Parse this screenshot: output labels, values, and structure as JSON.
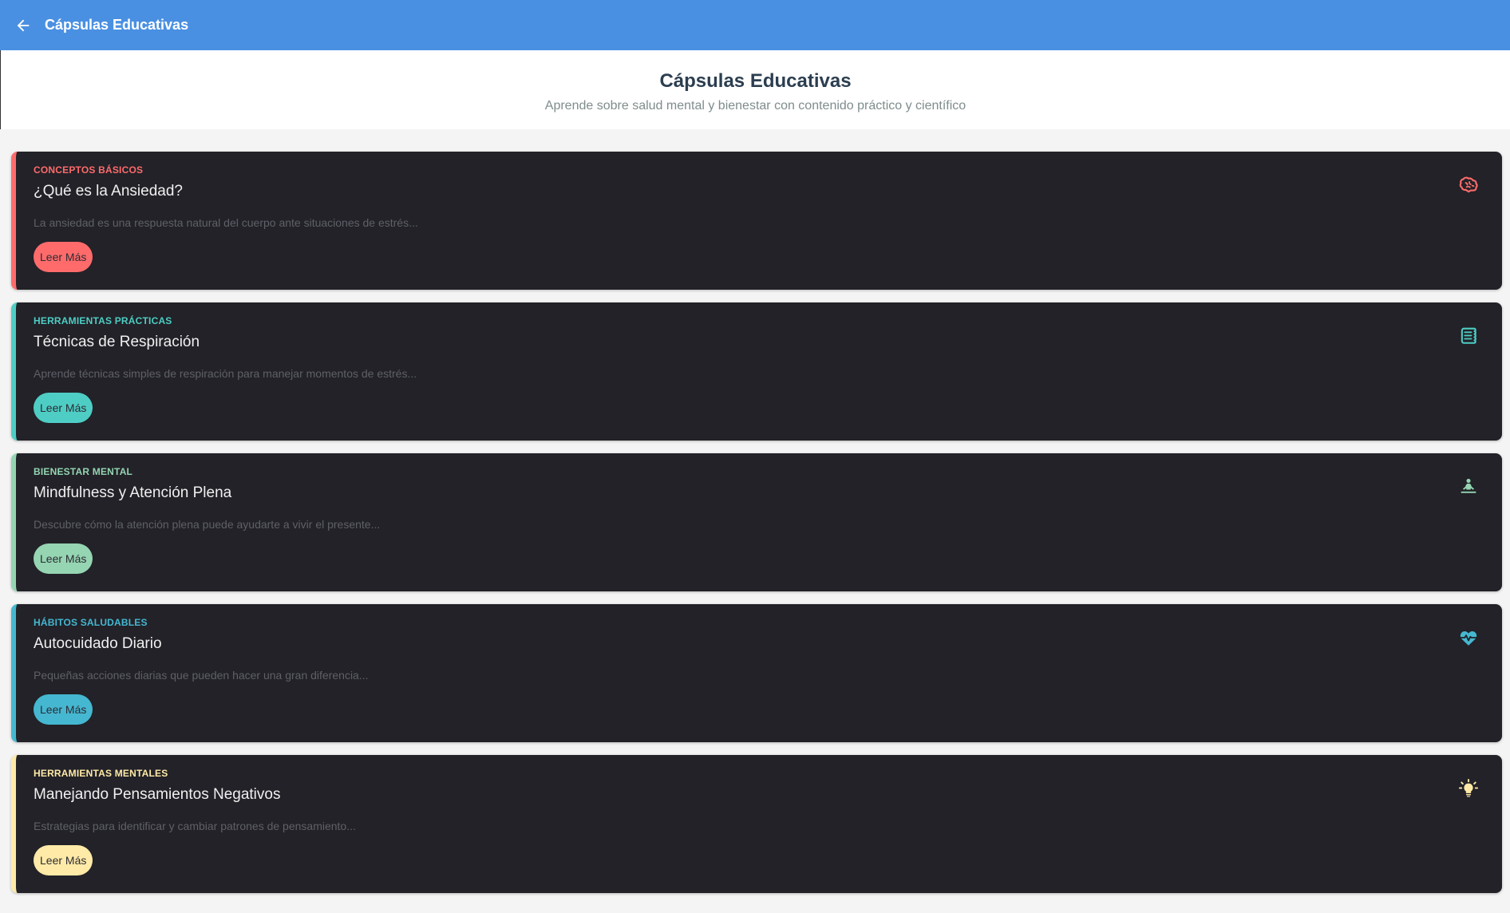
{
  "appbar": {
    "title": "Cápsulas Educativas"
  },
  "header": {
    "title": "Cápsulas Educativas",
    "subtitle": "Aprende sobre salud mental y bienestar con contenido práctico y científico"
  },
  "cards": [
    {
      "category": "CONCEPTOS BÁSICOS",
      "title": "¿Qué es la Ansiedad?",
      "description": "La ansiedad es una respuesta natural del cuerpo ante situaciones de estrés...",
      "button": "Leer Más",
      "icon": "brain-icon",
      "color": "#ff6b6b"
    },
    {
      "category": "HERRAMIENTAS PRÁCTICAS",
      "title": "Técnicas de Respiración",
      "description": "Aprende técnicas simples de respiración para manejar momentos de estrés...",
      "button": "Leer Más",
      "icon": "lungs-icon",
      "color": "#4ecdc4"
    },
    {
      "category": "BIENESTAR MENTAL",
      "title": "Mindfulness y Atención Plena",
      "description": "Descubre cómo la atención plena puede ayudarte a vivir el presente...",
      "button": "Leer Más",
      "icon": "meditation-icon",
      "color": "#95d5b2"
    },
    {
      "category": "HÁBITOS SALUDABLES",
      "title": "Autocuidado Diario",
      "description": "Pequeñas acciones diarias que pueden hacer una gran diferencia...",
      "button": "Leer Más",
      "icon": "heart-pulse-icon",
      "color": "#45b7d1"
    },
    {
      "category": "HERRAMIENTAS MENTALES",
      "title": "Manejando Pensamientos Negativos",
      "description": "Estrategias para identificar y cambiar patrones de pensamiento...",
      "button": "Leer Más",
      "icon": "lightbulb-icon",
      "color": "#ffeaa7"
    }
  ]
}
